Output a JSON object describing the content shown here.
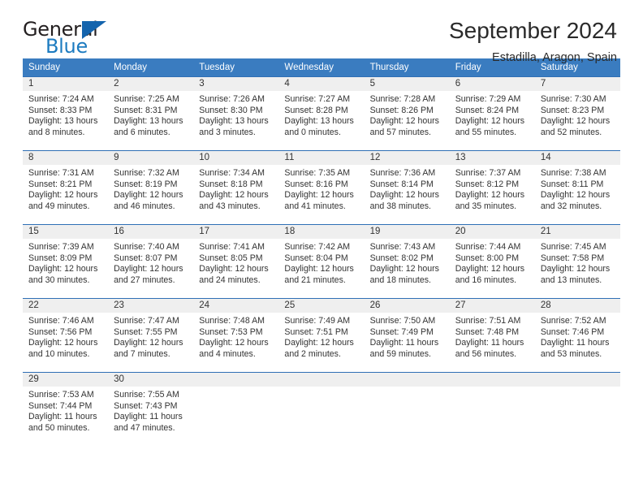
{
  "logo": {
    "word_top": "General",
    "word_bottom": "Blue",
    "triangle_color": "#1464ad",
    "blue_color": "#1c7bc0"
  },
  "header": {
    "title": "September 2024",
    "subtitle": "Estadilla, Aragon, Spain"
  },
  "calendar": {
    "header_color": "#3a7cc0",
    "row_rule_color": "#2f6fb5",
    "datenum_bg": "#efefef",
    "weekdays": [
      "Sunday",
      "Monday",
      "Tuesday",
      "Wednesday",
      "Thursday",
      "Friday",
      "Saturday"
    ],
    "weeks": [
      [
        {
          "date": "1",
          "sunrise": "Sunrise: 7:24 AM",
          "sunset": "Sunset: 8:33 PM",
          "daylight1": "Daylight: 13 hours",
          "daylight2": "and 8 minutes."
        },
        {
          "date": "2",
          "sunrise": "Sunrise: 7:25 AM",
          "sunset": "Sunset: 8:31 PM",
          "daylight1": "Daylight: 13 hours",
          "daylight2": "and 6 minutes."
        },
        {
          "date": "3",
          "sunrise": "Sunrise: 7:26 AM",
          "sunset": "Sunset: 8:30 PM",
          "daylight1": "Daylight: 13 hours",
          "daylight2": "and 3 minutes."
        },
        {
          "date": "4",
          "sunrise": "Sunrise: 7:27 AM",
          "sunset": "Sunset: 8:28 PM",
          "daylight1": "Daylight: 13 hours",
          "daylight2": "and 0 minutes."
        },
        {
          "date": "5",
          "sunrise": "Sunrise: 7:28 AM",
          "sunset": "Sunset: 8:26 PM",
          "daylight1": "Daylight: 12 hours",
          "daylight2": "and 57 minutes."
        },
        {
          "date": "6",
          "sunrise": "Sunrise: 7:29 AM",
          "sunset": "Sunset: 8:24 PM",
          "daylight1": "Daylight: 12 hours",
          "daylight2": "and 55 minutes."
        },
        {
          "date": "7",
          "sunrise": "Sunrise: 7:30 AM",
          "sunset": "Sunset: 8:23 PM",
          "daylight1": "Daylight: 12 hours",
          "daylight2": "and 52 minutes."
        }
      ],
      [
        {
          "date": "8",
          "sunrise": "Sunrise: 7:31 AM",
          "sunset": "Sunset: 8:21 PM",
          "daylight1": "Daylight: 12 hours",
          "daylight2": "and 49 minutes."
        },
        {
          "date": "9",
          "sunrise": "Sunrise: 7:32 AM",
          "sunset": "Sunset: 8:19 PM",
          "daylight1": "Daylight: 12 hours",
          "daylight2": "and 46 minutes."
        },
        {
          "date": "10",
          "sunrise": "Sunrise: 7:34 AM",
          "sunset": "Sunset: 8:18 PM",
          "daylight1": "Daylight: 12 hours",
          "daylight2": "and 43 minutes."
        },
        {
          "date": "11",
          "sunrise": "Sunrise: 7:35 AM",
          "sunset": "Sunset: 8:16 PM",
          "daylight1": "Daylight: 12 hours",
          "daylight2": "and 41 minutes."
        },
        {
          "date": "12",
          "sunrise": "Sunrise: 7:36 AM",
          "sunset": "Sunset: 8:14 PM",
          "daylight1": "Daylight: 12 hours",
          "daylight2": "and 38 minutes."
        },
        {
          "date": "13",
          "sunrise": "Sunrise: 7:37 AM",
          "sunset": "Sunset: 8:12 PM",
          "daylight1": "Daylight: 12 hours",
          "daylight2": "and 35 minutes."
        },
        {
          "date": "14",
          "sunrise": "Sunrise: 7:38 AM",
          "sunset": "Sunset: 8:11 PM",
          "daylight1": "Daylight: 12 hours",
          "daylight2": "and 32 minutes."
        }
      ],
      [
        {
          "date": "15",
          "sunrise": "Sunrise: 7:39 AM",
          "sunset": "Sunset: 8:09 PM",
          "daylight1": "Daylight: 12 hours",
          "daylight2": "and 30 minutes."
        },
        {
          "date": "16",
          "sunrise": "Sunrise: 7:40 AM",
          "sunset": "Sunset: 8:07 PM",
          "daylight1": "Daylight: 12 hours",
          "daylight2": "and 27 minutes."
        },
        {
          "date": "17",
          "sunrise": "Sunrise: 7:41 AM",
          "sunset": "Sunset: 8:05 PM",
          "daylight1": "Daylight: 12 hours",
          "daylight2": "and 24 minutes."
        },
        {
          "date": "18",
          "sunrise": "Sunrise: 7:42 AM",
          "sunset": "Sunset: 8:04 PM",
          "daylight1": "Daylight: 12 hours",
          "daylight2": "and 21 minutes."
        },
        {
          "date": "19",
          "sunrise": "Sunrise: 7:43 AM",
          "sunset": "Sunset: 8:02 PM",
          "daylight1": "Daylight: 12 hours",
          "daylight2": "and 18 minutes."
        },
        {
          "date": "20",
          "sunrise": "Sunrise: 7:44 AM",
          "sunset": "Sunset: 8:00 PM",
          "daylight1": "Daylight: 12 hours",
          "daylight2": "and 16 minutes."
        },
        {
          "date": "21",
          "sunrise": "Sunrise: 7:45 AM",
          "sunset": "Sunset: 7:58 PM",
          "daylight1": "Daylight: 12 hours",
          "daylight2": "and 13 minutes."
        }
      ],
      [
        {
          "date": "22",
          "sunrise": "Sunrise: 7:46 AM",
          "sunset": "Sunset: 7:56 PM",
          "daylight1": "Daylight: 12 hours",
          "daylight2": "and 10 minutes."
        },
        {
          "date": "23",
          "sunrise": "Sunrise: 7:47 AM",
          "sunset": "Sunset: 7:55 PM",
          "daylight1": "Daylight: 12 hours",
          "daylight2": "and 7 minutes."
        },
        {
          "date": "24",
          "sunrise": "Sunrise: 7:48 AM",
          "sunset": "Sunset: 7:53 PM",
          "daylight1": "Daylight: 12 hours",
          "daylight2": "and 4 minutes."
        },
        {
          "date": "25",
          "sunrise": "Sunrise: 7:49 AM",
          "sunset": "Sunset: 7:51 PM",
          "daylight1": "Daylight: 12 hours",
          "daylight2": "and 2 minutes."
        },
        {
          "date": "26",
          "sunrise": "Sunrise: 7:50 AM",
          "sunset": "Sunset: 7:49 PM",
          "daylight1": "Daylight: 11 hours",
          "daylight2": "and 59 minutes."
        },
        {
          "date": "27",
          "sunrise": "Sunrise: 7:51 AM",
          "sunset": "Sunset: 7:48 PM",
          "daylight1": "Daylight: 11 hours",
          "daylight2": "and 56 minutes."
        },
        {
          "date": "28",
          "sunrise": "Sunrise: 7:52 AM",
          "sunset": "Sunset: 7:46 PM",
          "daylight1": "Daylight: 11 hours",
          "daylight2": "and 53 minutes."
        }
      ],
      [
        {
          "date": "29",
          "sunrise": "Sunrise: 7:53 AM",
          "sunset": "Sunset: 7:44 PM",
          "daylight1": "Daylight: 11 hours",
          "daylight2": "and 50 minutes."
        },
        {
          "date": "30",
          "sunrise": "Sunrise: 7:55 AM",
          "sunset": "Sunset: 7:43 PM",
          "daylight1": "Daylight: 11 hours",
          "daylight2": "and 47 minutes."
        },
        {
          "date": "",
          "sunrise": "",
          "sunset": "",
          "daylight1": "",
          "daylight2": ""
        },
        {
          "date": "",
          "sunrise": "",
          "sunset": "",
          "daylight1": "",
          "daylight2": ""
        },
        {
          "date": "",
          "sunrise": "",
          "sunset": "",
          "daylight1": "",
          "daylight2": ""
        },
        {
          "date": "",
          "sunrise": "",
          "sunset": "",
          "daylight1": "",
          "daylight2": ""
        },
        {
          "date": "",
          "sunrise": "",
          "sunset": "",
          "daylight1": "",
          "daylight2": ""
        }
      ]
    ]
  }
}
